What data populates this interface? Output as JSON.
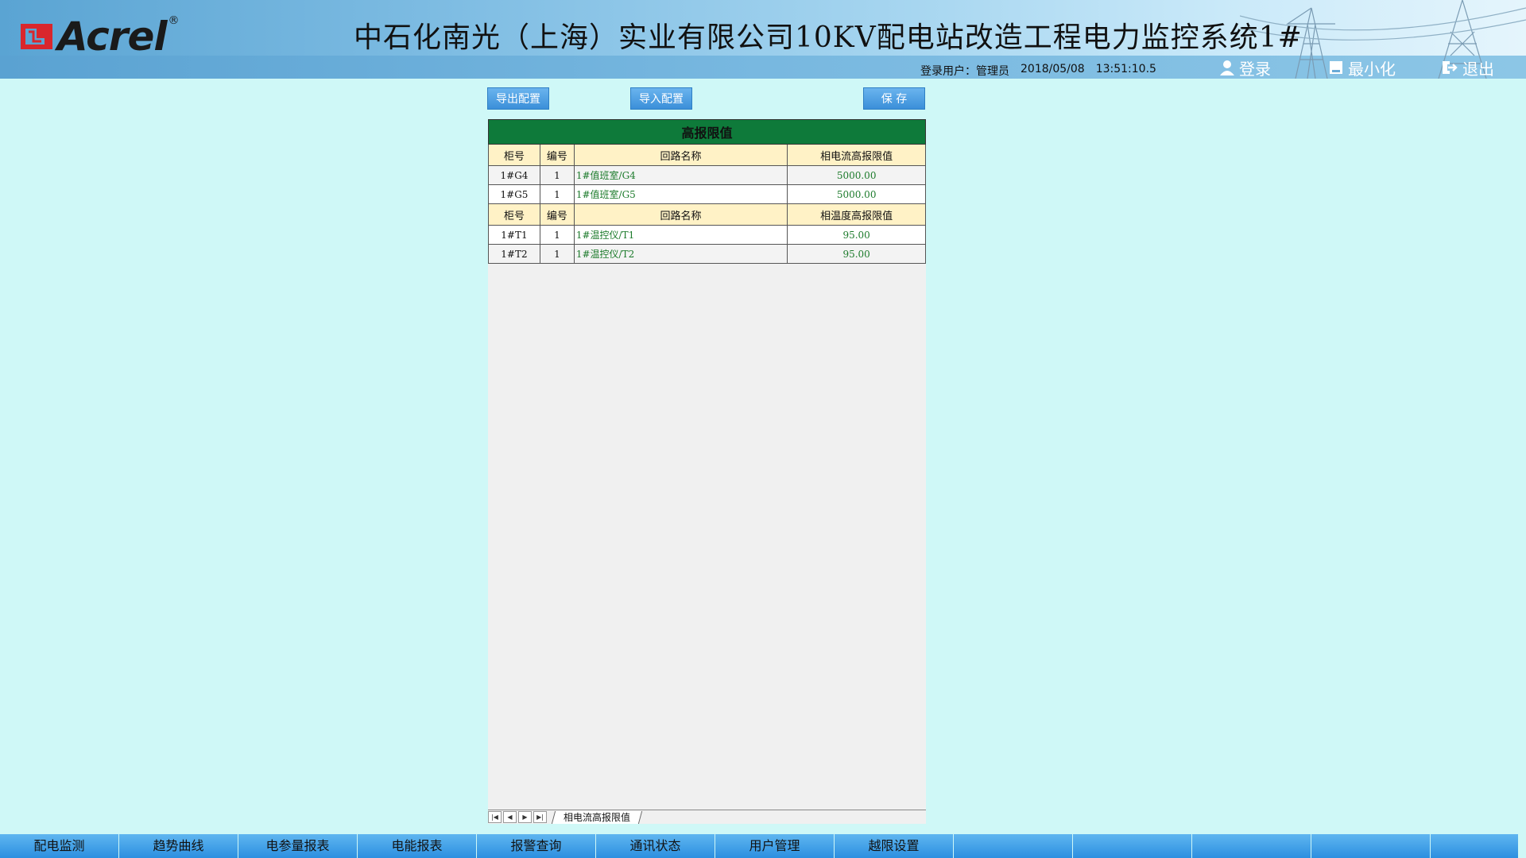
{
  "header": {
    "brand": "Acrel",
    "brand_mark": "®",
    "title": "中石化南光（上海）实业有限公司10KV配电站改造工程电力监控系统1#",
    "login_label": "登录用户：",
    "user": "管理员",
    "date": "2018/05/08",
    "time": "13:51:10.5",
    "buttons": {
      "login": "登录",
      "minimize": "最小化",
      "logout": "退出"
    }
  },
  "toolbar": {
    "export_label": "导出配置",
    "import_label": "导入配置",
    "save_label": "保 存"
  },
  "table": {
    "caption": "高报限值",
    "sections": [
      {
        "headers": [
          "柜号",
          "编号",
          "回路名称",
          "相电流高报限值"
        ],
        "rows": [
          [
            "1#G4",
            "1",
            "1#值班室/G4",
            "5000.00"
          ],
          [
            "1#G5",
            "1",
            "1#值班室/G5",
            "5000.00"
          ]
        ]
      },
      {
        "headers": [
          "柜号",
          "编号",
          "回路名称",
          "相温度高报限值"
        ],
        "rows": [
          [
            "1#T1",
            "1",
            "1#温控仪/T1",
            "95.00"
          ],
          [
            "1#T2",
            "1",
            "1#温控仪/T2",
            "95.00"
          ]
        ]
      }
    ]
  },
  "sheet_tab": "相电流高报限值",
  "nav": [
    "配电监测",
    "趋势曲线",
    "电参量报表",
    "电能报表",
    "报警查询",
    "通讯状态",
    "用户管理",
    "越限设置",
    "",
    "",
    "",
    "",
    ""
  ],
  "colors": {
    "background": "#cff8f7",
    "caption_bg": "#0e7a3a",
    "header_cell_bg": "#fff2c6",
    "value_text": "#1b7a2a",
    "button_blue": "#3b8fd9"
  }
}
